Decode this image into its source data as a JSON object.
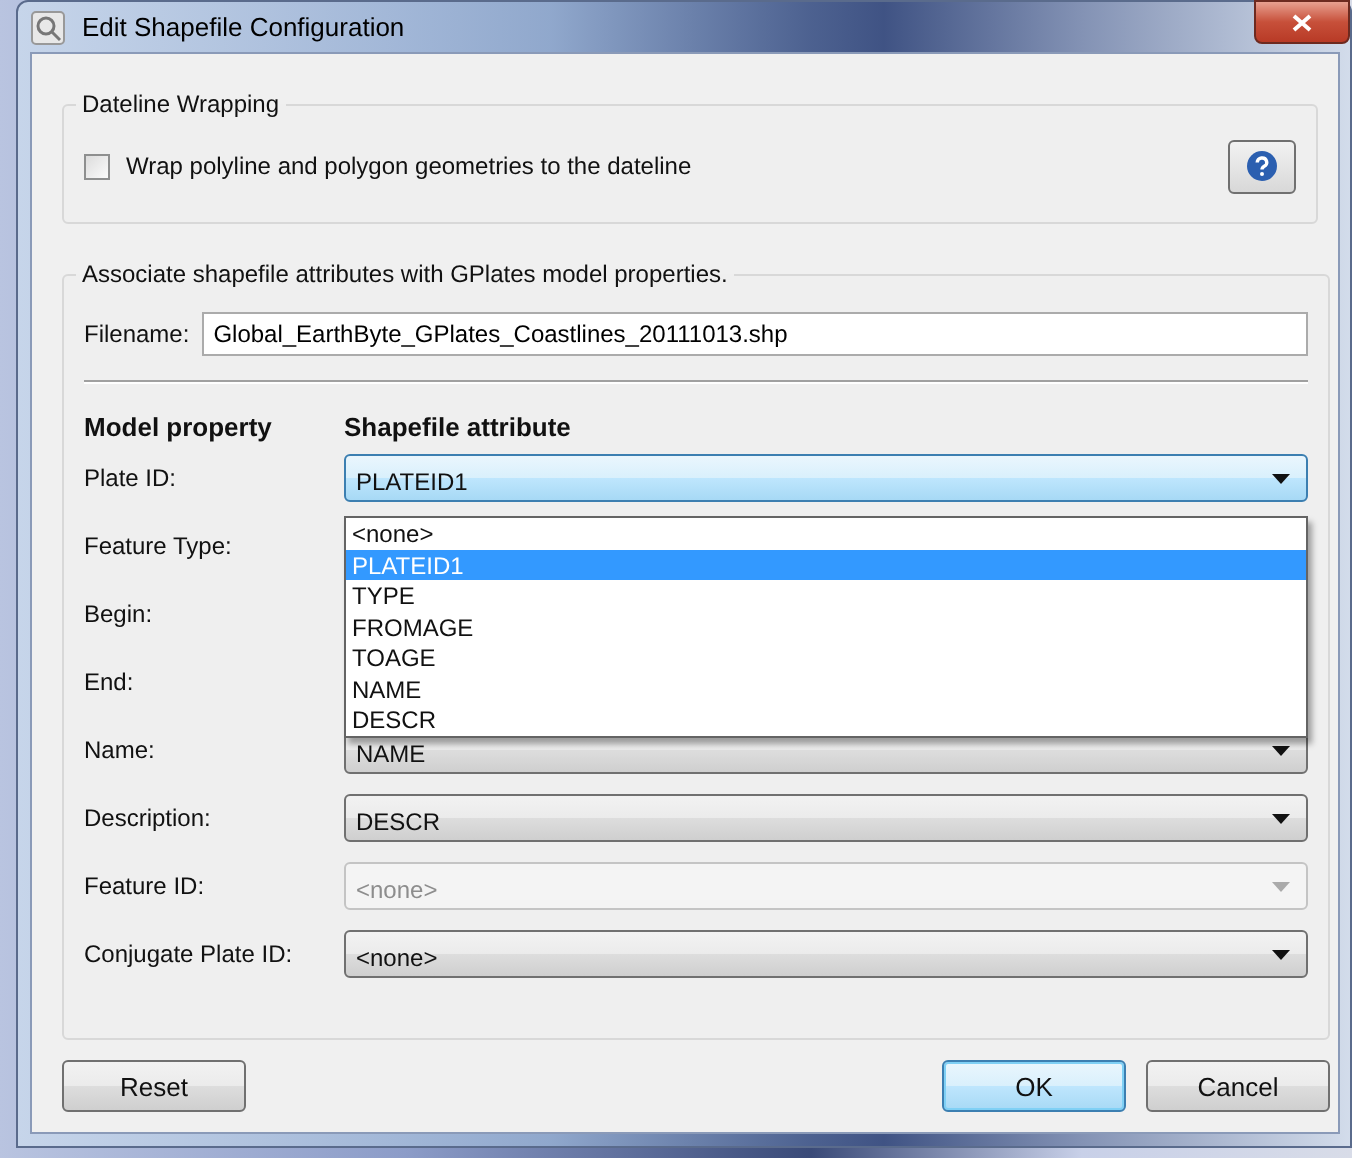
{
  "window": {
    "title": "Edit Shapefile Configuration"
  },
  "dateline": {
    "title": "Dateline Wrapping",
    "checkbox": {
      "label": "Wrap polyline and polygon geometries to the dateline",
      "checked": false
    }
  },
  "association": {
    "title": "Associate shapefile attributes with GPlates model properties.",
    "filename_label": "Filename:",
    "filename": "Global_EarthByte_GPlates_Coastlines_20111013.shp",
    "headers": [
      "Model property",
      "Shapefile attribute"
    ],
    "rows": [
      {
        "label": "Plate ID:",
        "value": "PLATEID1",
        "disabled": false,
        "expanded": true
      },
      {
        "label": "Feature Type:"
      },
      {
        "label": "Begin:"
      },
      {
        "label": "End:"
      },
      {
        "label": "Name:",
        "value": "NAME",
        "disabled": false,
        "expanded": false
      },
      {
        "label": "Description:",
        "value": "DESCR",
        "disabled": false,
        "expanded": false
      },
      {
        "label": "Feature ID:",
        "value": "<none>",
        "disabled": true,
        "expanded": false
      },
      {
        "label": "Conjugate Plate ID:",
        "value": "<none>",
        "disabled": false,
        "expanded": false
      }
    ],
    "dropdown_options": [
      {
        "label": "<none>",
        "selected": false
      },
      {
        "label": "PLATEID1",
        "selected": true
      },
      {
        "label": "TYPE",
        "selected": false
      },
      {
        "label": "FROMAGE",
        "selected": false
      },
      {
        "label": "TOAGE",
        "selected": false
      },
      {
        "label": "NAME",
        "selected": false
      },
      {
        "label": "DESCR",
        "selected": false
      }
    ]
  },
  "buttons": [
    {
      "label": "Reset",
      "kind": "plain"
    },
    {
      "label": "OK",
      "kind": "default"
    },
    {
      "label": "Cancel",
      "kind": "plain"
    }
  ]
}
